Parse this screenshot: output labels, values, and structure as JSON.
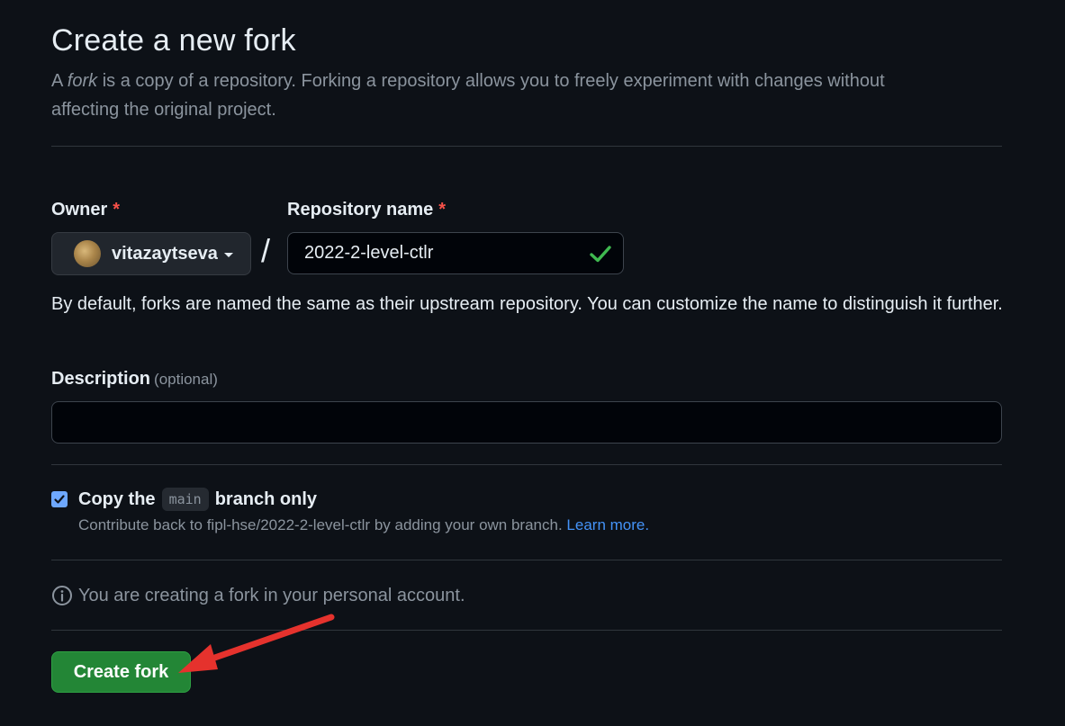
{
  "header": {
    "title": "Create a new fork",
    "subtitle_prefix": "A ",
    "subtitle_em": "fork",
    "subtitle_rest": " is a copy of a repository. Forking a repository allows you to freely experiment with changes without affecting the original project."
  },
  "owner": {
    "label": "Owner",
    "required_mark": "*",
    "selected": "vitazaytseva",
    "avatar_icon": "user-avatar"
  },
  "separator": "/",
  "repository": {
    "label": "Repository name",
    "required_mark": "*",
    "value": "2022-2-level-ctlr",
    "valid_icon": "check-icon",
    "help_text": "By default, forks are named the same as their upstream repository. You can customize the name to distinguish it further."
  },
  "description": {
    "label": "Description",
    "optional": "(optional)",
    "value": ""
  },
  "copy_branch": {
    "checked": true,
    "label_before": "Copy the",
    "branch": "main",
    "label_after": "branch only",
    "sub_text": "Contribute back to fipl-hse/2022-2-level-ctlr by adding your own branch.",
    "link": "Learn more."
  },
  "info": {
    "icon": "info-icon",
    "text": "You are creating a fork in your personal account."
  },
  "actions": {
    "create_label": "Create fork"
  },
  "colors": {
    "background": "#0d1117",
    "primary_button": "#238636",
    "required": "#f85149",
    "link": "#4493f8",
    "valid": "#3fb950",
    "annotation_arrow": "#e5322d"
  }
}
